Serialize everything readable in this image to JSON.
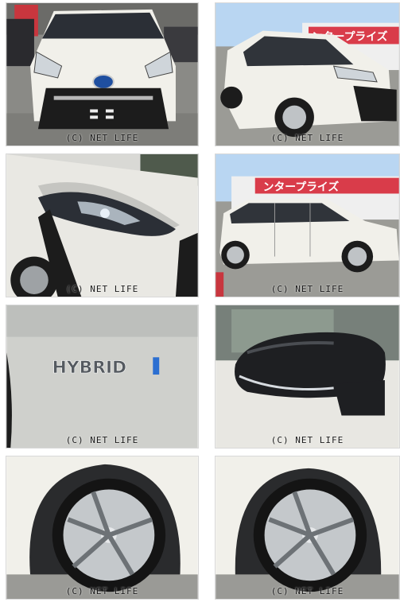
{
  "watermark": "(C) NET LIFE",
  "sign_text": "ンタープライズ",
  "badge_text": "HYBRID",
  "photos": [
    {
      "name": "front-view"
    },
    {
      "name": "front-quarter-view"
    },
    {
      "name": "headlight-closeup"
    },
    {
      "name": "side-view"
    },
    {
      "name": "hybrid-badge"
    },
    {
      "name": "side-mirror"
    },
    {
      "name": "front-wheel"
    },
    {
      "name": "rear-wheel"
    }
  ],
  "colors": {
    "body_white": "#f1f0ea",
    "dark": "#1c1c1c",
    "sky": "#b9d6f2",
    "sign_red": "#d93c4a"
  }
}
